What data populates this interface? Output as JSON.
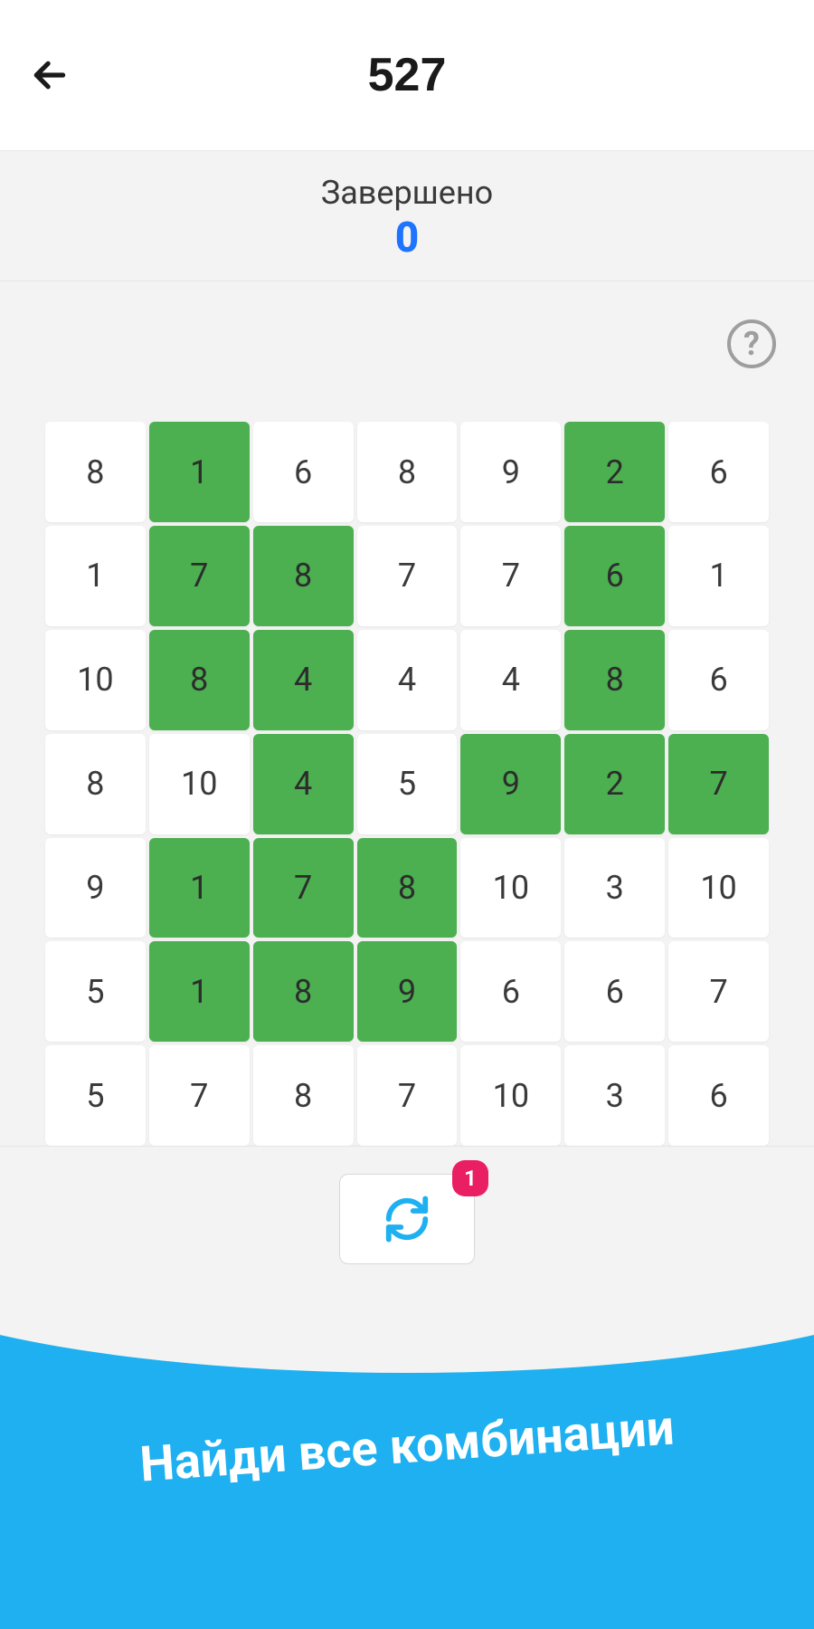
{
  "header": {
    "title": "527"
  },
  "status": {
    "label": "Завершено",
    "value": "0"
  },
  "help_icon": "?",
  "grid": [
    [
      {
        "v": "8",
        "h": 0
      },
      {
        "v": "1",
        "h": 1
      },
      {
        "v": "6",
        "h": 0
      },
      {
        "v": "8",
        "h": 0
      },
      {
        "v": "9",
        "h": 0
      },
      {
        "v": "2",
        "h": 1
      },
      {
        "v": "6",
        "h": 0
      }
    ],
    [
      {
        "v": "1",
        "h": 0
      },
      {
        "v": "7",
        "h": 1
      },
      {
        "v": "8",
        "h": 1
      },
      {
        "v": "7",
        "h": 0
      },
      {
        "v": "7",
        "h": 0
      },
      {
        "v": "6",
        "h": 1
      },
      {
        "v": "1",
        "h": 0
      }
    ],
    [
      {
        "v": "10",
        "h": 0
      },
      {
        "v": "8",
        "h": 1
      },
      {
        "v": "4",
        "h": 1
      },
      {
        "v": "4",
        "h": 0
      },
      {
        "v": "4",
        "h": 0
      },
      {
        "v": "8",
        "h": 1
      },
      {
        "v": "6",
        "h": 0
      }
    ],
    [
      {
        "v": "8",
        "h": 0
      },
      {
        "v": "10",
        "h": 0
      },
      {
        "v": "4",
        "h": 1
      },
      {
        "v": "5",
        "h": 0
      },
      {
        "v": "9",
        "h": 1
      },
      {
        "v": "2",
        "h": 1
      },
      {
        "v": "7",
        "h": 1
      }
    ],
    [
      {
        "v": "9",
        "h": 0
      },
      {
        "v": "1",
        "h": 1
      },
      {
        "v": "7",
        "h": 1
      },
      {
        "v": "8",
        "h": 1
      },
      {
        "v": "10",
        "h": 0
      },
      {
        "v": "3",
        "h": 0
      },
      {
        "v": "10",
        "h": 0
      }
    ],
    [
      {
        "v": "5",
        "h": 0
      },
      {
        "v": "1",
        "h": 1
      },
      {
        "v": "8",
        "h": 1
      },
      {
        "v": "9",
        "h": 1
      },
      {
        "v": "6",
        "h": 0
      },
      {
        "v": "6",
        "h": 0
      },
      {
        "v": "7",
        "h": 0
      }
    ],
    [
      {
        "v": "5",
        "h": 0
      },
      {
        "v": "7",
        "h": 0
      },
      {
        "v": "8",
        "h": 0
      },
      {
        "v": "7",
        "h": 0
      },
      {
        "v": "10",
        "h": 0
      },
      {
        "v": "3",
        "h": 0
      },
      {
        "v": "6",
        "h": 0
      }
    ]
  ],
  "refresh": {
    "badge": "1"
  },
  "banner": {
    "text": "Найди все комбинации"
  }
}
